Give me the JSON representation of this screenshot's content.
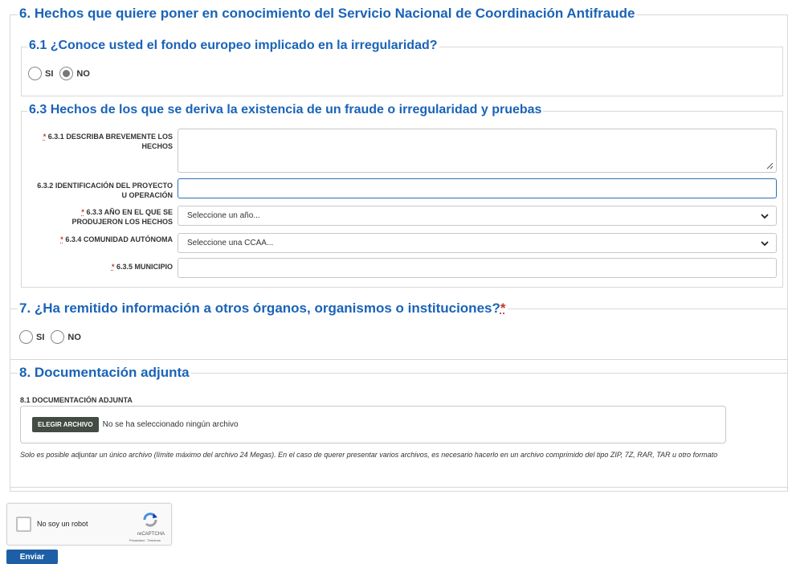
{
  "section6": {
    "title": "6. Hechos que quiere poner en conocimiento del Servicio Nacional de Coordinación Antifraude",
    "q61": {
      "title": "6.1 ¿Conoce usted el fondo europeo implicado en la irregularidad?",
      "options": [
        {
          "label": "SI",
          "checked": false
        },
        {
          "label": "NO",
          "checked": true
        }
      ]
    },
    "q63": {
      "title": "6.3 Hechos de los que se deriva la existencia de un fraude o irregularidad y pruebas",
      "required_marker": "*",
      "f631_label": "6.3.1 DESCRIBA BREVEMENTE LOS HECHOS",
      "f632_label": "6.3.2 IDENTIFICACIÓN DEL PROYECTO U OPERACIÓN",
      "f633_label": "6.3.3 AÑO EN EL QUE SE PRODUJERON LOS HECHOS",
      "f633_value": "Seleccione un año...",
      "f634_label": "6.3.4 COMUNIDAD AUTÓNOMA",
      "f634_value": "Seleccione una CCAA...",
      "f635_label": "6.3.5 MUNICIPIO"
    }
  },
  "section7": {
    "title": "7. ¿Ha remitido información a otros órganos, organismos o instituciones?",
    "required_marker": "*",
    "options": [
      {
        "label": "SI",
        "checked": false
      },
      {
        "label": "NO",
        "checked": false
      }
    ]
  },
  "section8": {
    "title": "8. Documentación adjunta",
    "field_label": "8.1 DOCUMENTACIÓN ADJUNTA",
    "button_label": "ELEGIR ARCHIVO",
    "file_status": "No se ha seleccionado ningún archivo",
    "note": "Solo es posible adjuntar un único archivo (límite máximo del archivo 24 Megas). En el caso de querer presentar varios archivos, es necesario hacerlo en un archivo comprimido del tipo ZIP, 7Z, RAR, TAR u otro formato"
  },
  "captcha": {
    "label": "No soy un robot",
    "brand": "reCAPTCHA",
    "links": "Privacidad - Términos"
  },
  "submit_label": "Enviar",
  "colors": {
    "legend": "#1a63b8",
    "required": "#c0392b",
    "submit": "#1d5fa6",
    "file_button": "#444a44"
  }
}
